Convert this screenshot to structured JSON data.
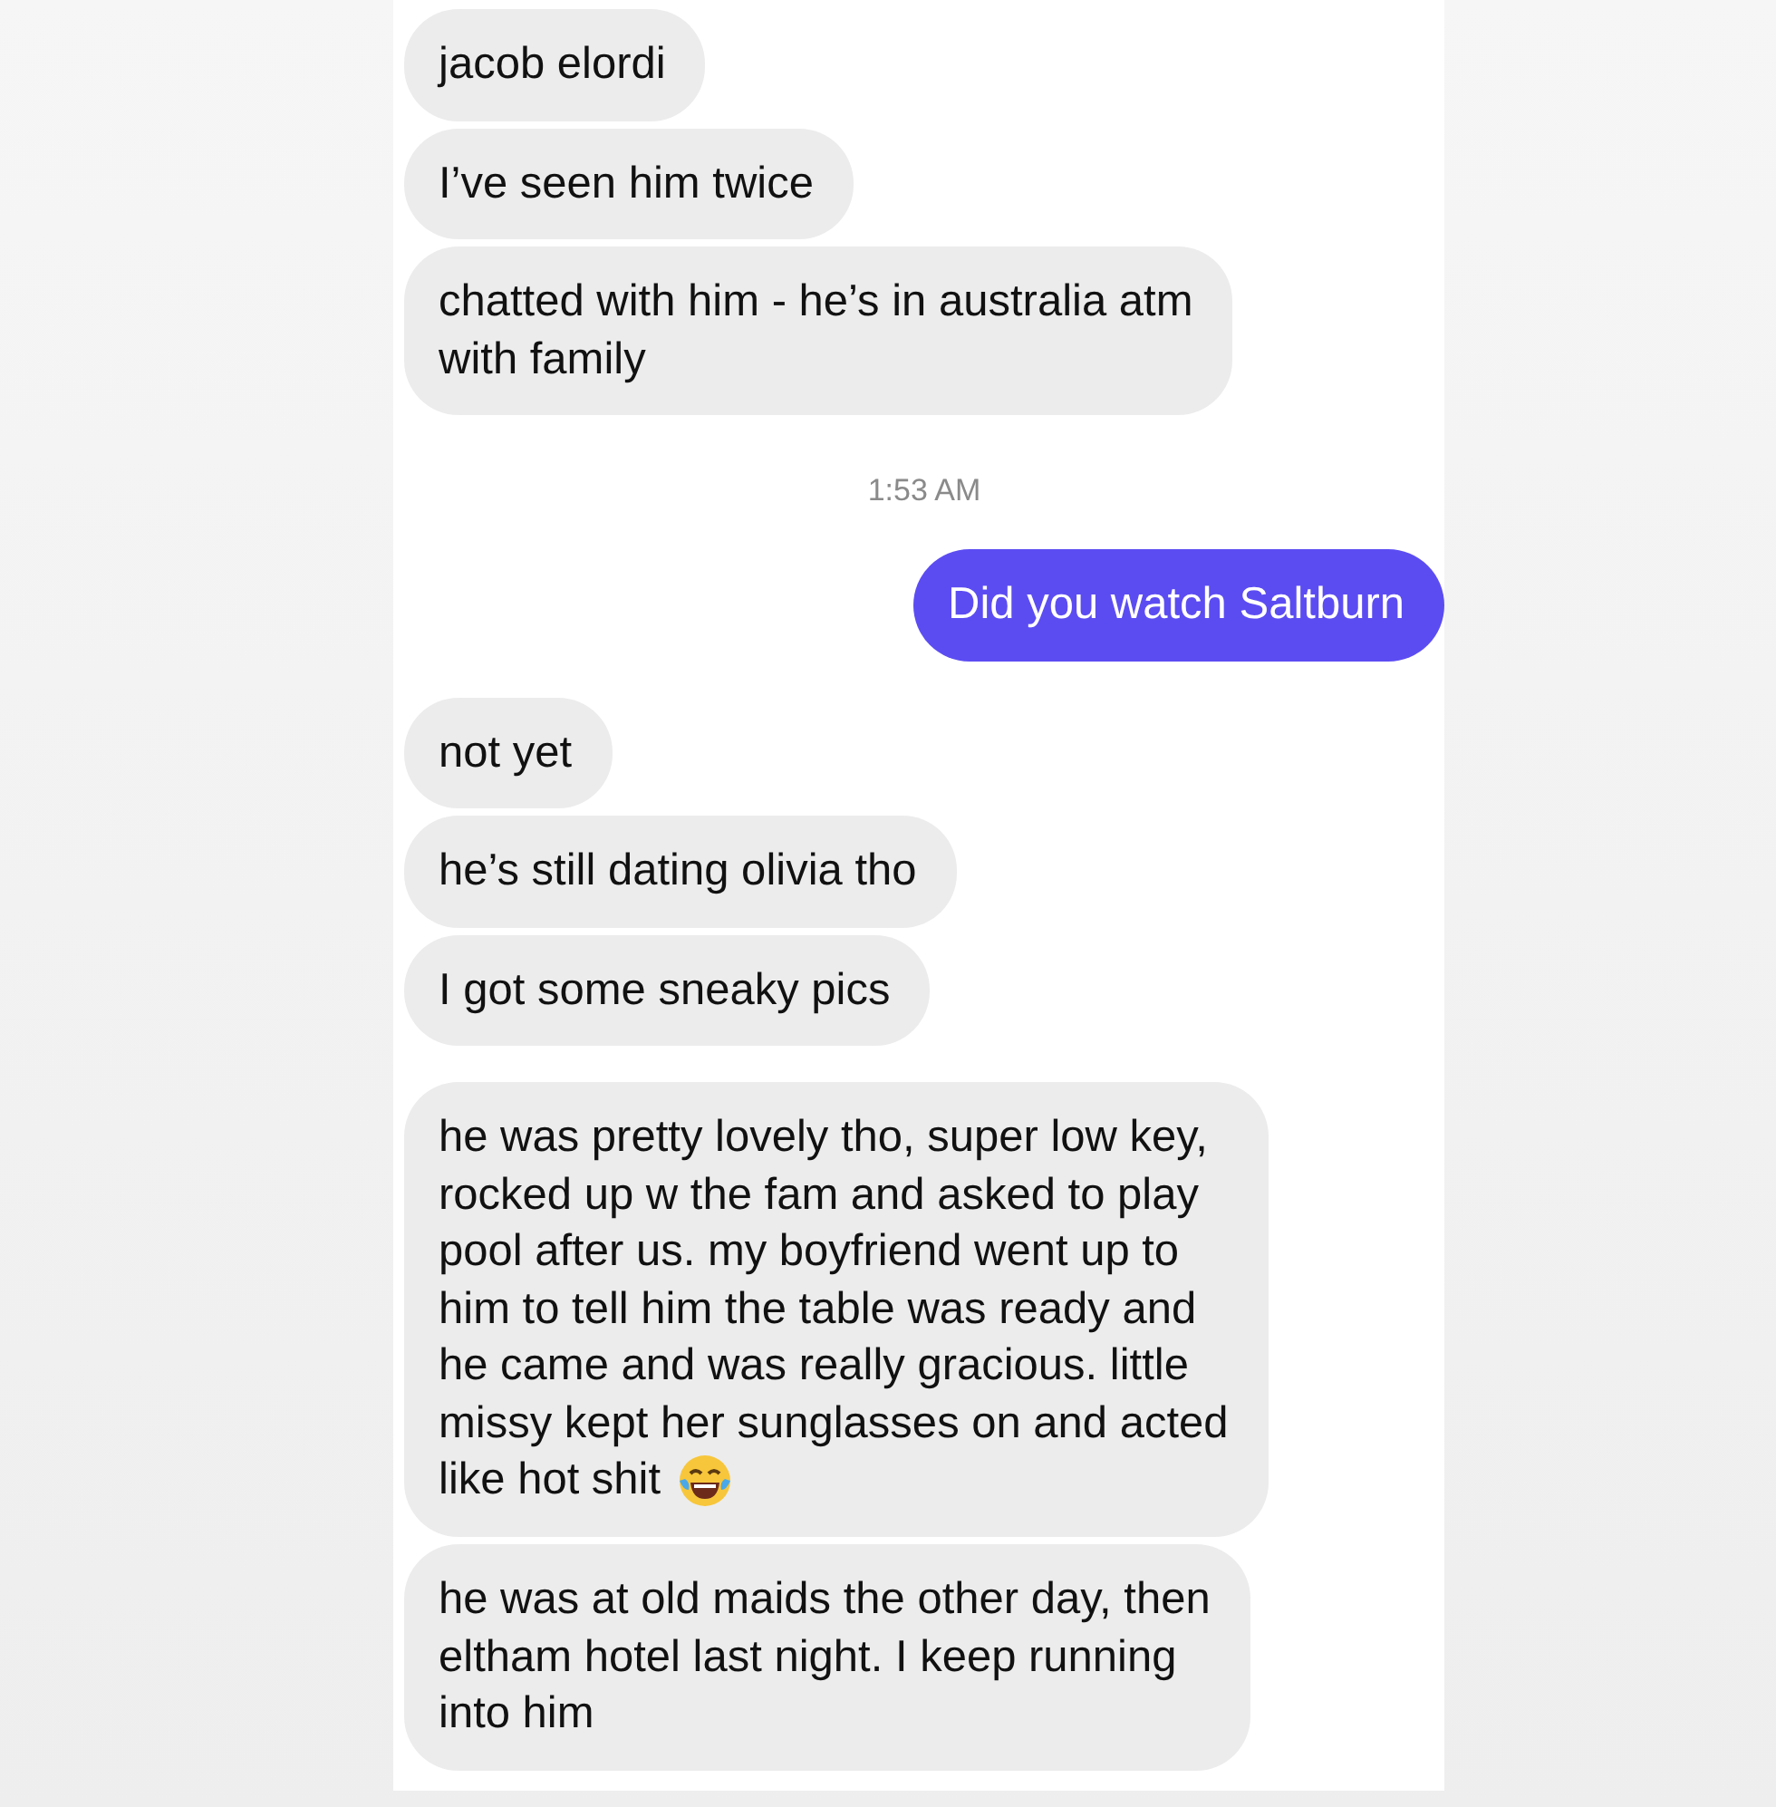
{
  "thread": [
    {
      "kind": "group",
      "outgoing": false,
      "messages": [
        {
          "text": "jacob elordi"
        },
        {
          "text": "I’ve seen him twice"
        },
        {
          "text": "chatted with him - he’s in australia atm\nwith family"
        }
      ]
    },
    {
      "kind": "timestamp",
      "text": "1:53 AM"
    },
    {
      "kind": "group",
      "outgoing": true,
      "messages": [
        {
          "text": "Did you watch Saltburn"
        }
      ]
    },
    {
      "kind": "group",
      "outgoing": false,
      "messages": [
        {
          "text": "not yet"
        },
        {
          "text": "he’s still dating olivia tho"
        },
        {
          "text": "I got some sneaky pics"
        }
      ]
    },
    {
      "kind": "group",
      "outgoing": false,
      "messages": [
        {
          "text": "he was pretty lovely tho, super low key,\nrocked up w the fam and asked to play\npool after us. my boyfriend went up to\nhim to tell him the table was ready and\nhe came and was really gracious. little\nmissy kept her sunglasses on and acted",
          "emoji_line": {
            "text": "like hot shit"
          }
        },
        {
          "text": "he was at old maids the other day, then\neltham hotel last night. I keep running\ninto him"
        }
      ]
    }
  ]
}
